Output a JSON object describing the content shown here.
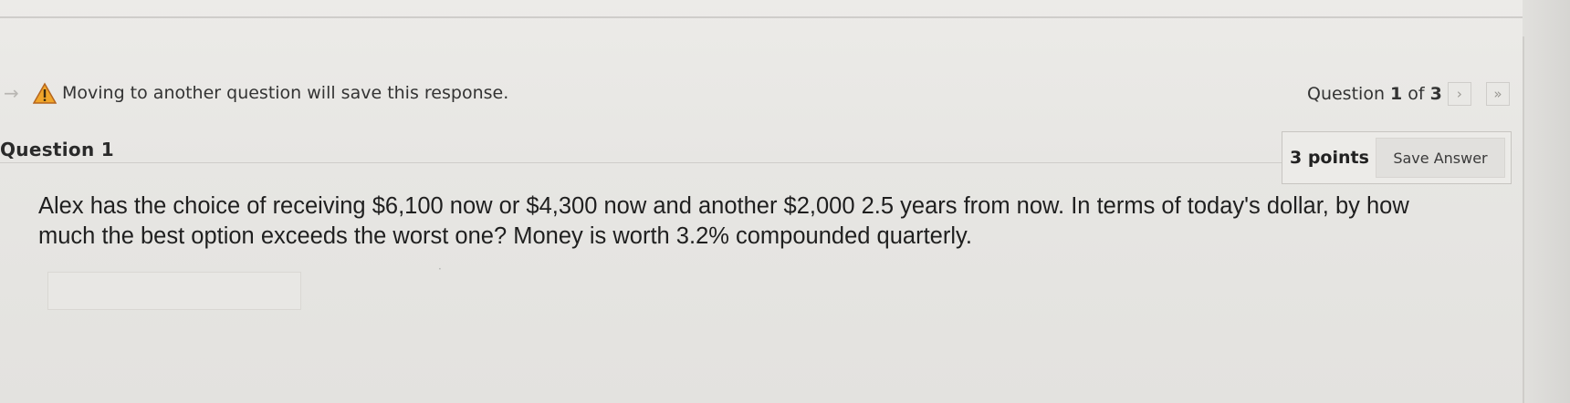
{
  "notice": {
    "text": "Moving to another question will save this response.",
    "icon": "warning-icon",
    "icon_color": "#e08a1e"
  },
  "navigation": {
    "prefix": "Question ",
    "current": "1",
    "middle": " of ",
    "total": "3",
    "next_glyph": "›",
    "last_glyph": "»"
  },
  "question": {
    "title": "Question 1",
    "points": "3 points",
    "save_label": "Save Answer",
    "body": "Alex has the choice of receiving $6,100 now or $4,300 now and another $2,000 2.5 years from now. In terms of today's dollar, by how much the best option exceeds the worst one? Money is worth 3.2% compounded quarterly.",
    "answer_value": ""
  }
}
